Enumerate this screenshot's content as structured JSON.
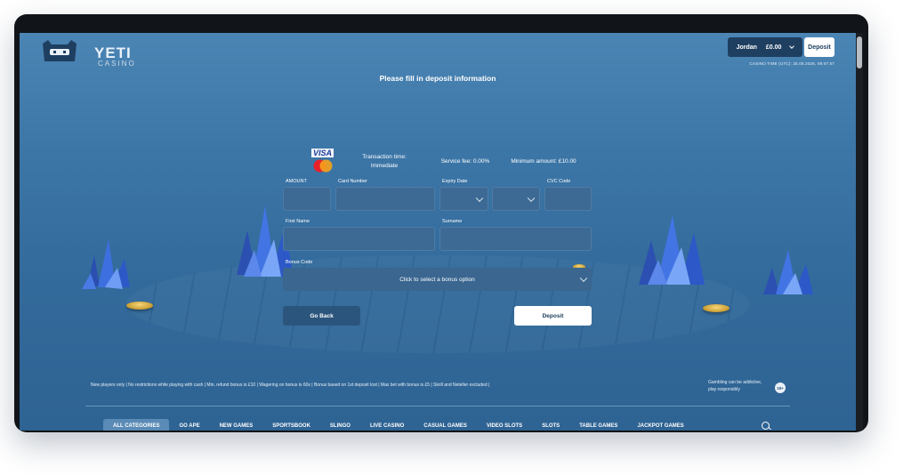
{
  "header": {
    "logo_text": "YETI",
    "logo_sub": "CASINO",
    "username": "Jordan",
    "balance": "£0.00",
    "deposit_label": "Deposit",
    "casino_time": "CASINO TIME (UTC): 25.05.2025, 09:07:57"
  },
  "page_title": "Please fill in deposit information",
  "payment_info": {
    "card_brand_visa": "VISA",
    "transaction_time_label": "Transaction time:",
    "transaction_time_value": "Immediate",
    "service_fee": "Service fee: 0.00%",
    "minimum_amount": "Minimum amount: £10.00"
  },
  "form": {
    "amount_label": "AMOUNT",
    "card_number_label": "Card Number",
    "expiry_label": "Expiry Date",
    "cvc_label": "CVC Code",
    "first_name_label": "First Name",
    "surname_label": "Surname",
    "bonus_code_label": "Bonus Code",
    "bonus_placeholder": "Click to select a bonus option",
    "go_back_label": "Go Back",
    "deposit_label": "Deposit"
  },
  "footer": {
    "terms": "New players only | No restrictions while playing with cash | Min. refund bonus is £10 | Wagering on bonus is 60x | Bonus based on 1st deposit lost | Max bet with bonus is £5 | Skrill and Neteller excluded |",
    "gambling_note_1": "Gambling can be addictive,",
    "gambling_note_2": "play responsibly",
    "age_badge": "18+"
  },
  "nav": {
    "items": [
      {
        "label": "ALL CATEGORIES",
        "active": true
      },
      {
        "label": "GO APE",
        "active": false
      },
      {
        "label": "NEW GAMES",
        "active": false
      },
      {
        "label": "SPORTSBOOK",
        "active": false
      },
      {
        "label": "SLINGO",
        "active": false
      },
      {
        "label": "LIVE CASINO",
        "active": false
      },
      {
        "label": "CASUAL GAMES",
        "active": false
      },
      {
        "label": "VIDEO SLOTS",
        "active": false
      },
      {
        "label": "SLOTS",
        "active": false
      },
      {
        "label": "TABLE GAMES",
        "active": false
      },
      {
        "label": "JACKPOT GAMES",
        "active": false
      }
    ]
  },
  "colors": {
    "accent_dark": "#1f3f60",
    "background": "#3c76a7",
    "field": "#3d6a94"
  }
}
